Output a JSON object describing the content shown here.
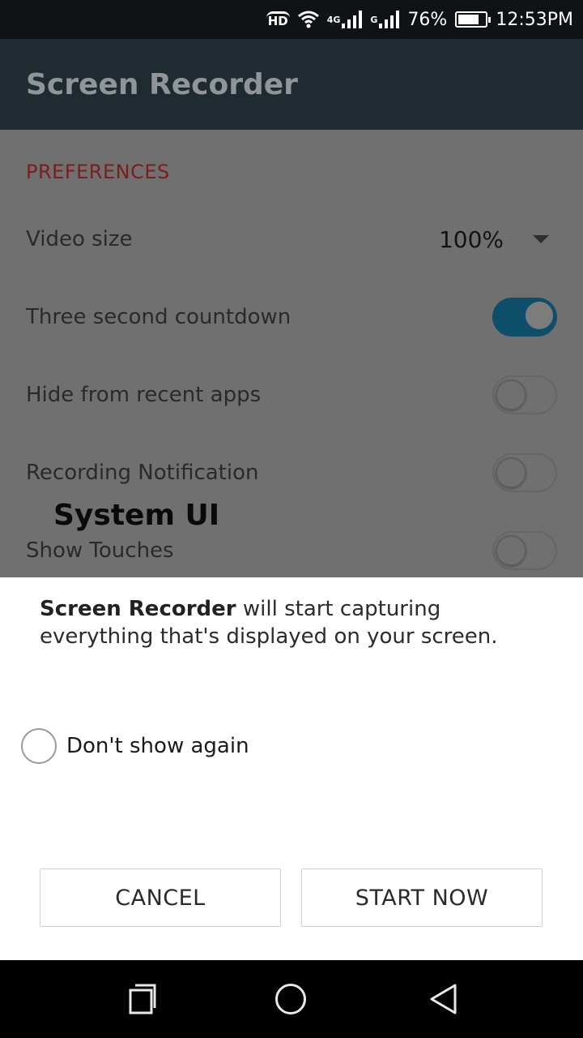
{
  "status_bar": {
    "hd_label": "HD",
    "network_label_1": "4G",
    "network_label_2": "G",
    "battery": "76%",
    "battery_level": 0.76,
    "time": "12:53PM"
  },
  "app": {
    "title": "Screen Recorder",
    "section_header": "PREFERENCES",
    "rows": [
      {
        "label": "Video size",
        "value": "100%"
      },
      {
        "label": "Three second countdown",
        "toggle": true
      },
      {
        "label": "Hide from recent apps",
        "toggle": false
      },
      {
        "label": "Recording Notification",
        "toggle": false
      },
      {
        "label": "Show Touches",
        "toggle": false
      }
    ],
    "overlay_label": "System UI"
  },
  "dialog": {
    "message_app": "Screen Recorder",
    "message_rest": " will start capturing everything that's displayed on your screen.",
    "checkbox_label": "Don't show again",
    "checkbox_checked": false,
    "cancel_label": "CANCEL",
    "start_label": "START NOW"
  },
  "nav": {
    "recent_icon": "recent-apps-icon",
    "home_icon": "home-icon",
    "back_icon": "back-icon"
  },
  "colors": {
    "toggle_on": "#0d4f6b",
    "section_header": "#7a1e1e",
    "app_bar": "#1f2b30"
  }
}
